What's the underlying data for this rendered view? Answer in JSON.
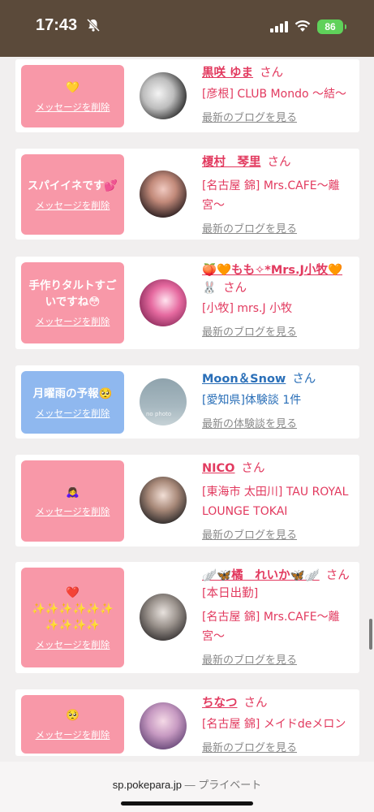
{
  "status": {
    "time": "17:43",
    "battery": "86"
  },
  "cards": [
    {
      "message": "💛",
      "delete_label": "メッセージを削除",
      "name": "黒咲 ゆま",
      "name_line2": "",
      "san": "さん",
      "shop": "[彦根] CLUB Mondo 〜結〜",
      "link": "最新のブログを見る",
      "color": "pink"
    },
    {
      "message": "スパイイネです💕",
      "delete_label": "メッセージを削除",
      "name": "榎村　琴里",
      "name_line2": "",
      "san": "さん",
      "shop": "[名古屋 錦] Mrs.CAFE〜離宮〜",
      "link": "最新のブログを見る",
      "color": "pink"
    },
    {
      "message": "手作りタルトすご\nいですね😳",
      "delete_label": "メッセージを削除",
      "name": "🍑🧡もも✧*Mrs.J小牧🧡",
      "name_line2": "🐰",
      "san": "さん",
      "shop": "[小牧] mrs.J 小牧",
      "link": "最新のブログを見る",
      "color": "pink"
    },
    {
      "message": "月曜雨の予報🥺",
      "delete_label": "メッセージを削除",
      "name": "Moon＆Snow",
      "name_line2": "",
      "san": "さん",
      "shop": "[愛知県]体験談 1件",
      "link": "最新の体験談を見る",
      "color": "blue"
    },
    {
      "message": "🙇‍♀️",
      "delete_label": "メッセージを削除",
      "name": "NICO",
      "name_line2": "",
      "san": "さん",
      "shop": "[東海市 太田川] TAU ROYAL LOUNGE TOKAI",
      "link": "最新のブログを見る",
      "color": "pink"
    },
    {
      "message": "❤️\n✨✨✨✨✨✨\n✨✨✨✨",
      "delete_label": "メッセージを削除",
      "name": "🪽🦋橘　れいか🦋🪽",
      "name_line2": "",
      "san": "さん[本日出勤]",
      "shop": "[名古屋 錦] Mrs.CAFE〜離宮〜",
      "link": "最新のブログを見る",
      "color": "pink"
    },
    {
      "message": "🥺",
      "delete_label": "メッセージを削除",
      "name": "ちなつ",
      "name_line2": "",
      "san": "さん",
      "shop": "[名古屋 錦] メイドdeメロン",
      "link": "最新のブログを見る",
      "color": "pink"
    }
  ],
  "browser": {
    "domain": "sp.pokepara.jp",
    "sep": " — ",
    "mode": "プライベート"
  }
}
